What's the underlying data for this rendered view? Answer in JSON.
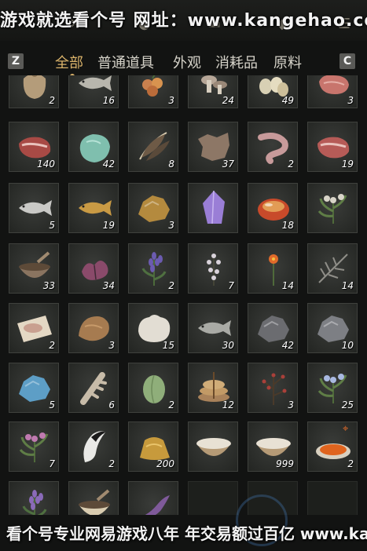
{
  "watermark_top": "游戏就选看个号  网址：www.kangehao.com",
  "watermark_bottom": "看个号专业网易游戏八年  年交易额过百亿 www.kangehao.com",
  "keys": {
    "left": "Z",
    "right": "C"
  },
  "tabs": [
    {
      "label": "全部",
      "active": true
    },
    {
      "label": "普通道具",
      "active": false
    },
    {
      "label": "外观",
      "active": false
    },
    {
      "label": "消耗品",
      "active": false
    },
    {
      "label": "原料",
      "active": false
    }
  ],
  "items": [
    {
      "name": "grain-sack",
      "qty": "2",
      "icon": "sack",
      "color": "#b49c7a"
    },
    {
      "name": "silver-fish",
      "qty": "16",
      "icon": "fish",
      "color": "#b8b6ad"
    },
    {
      "name": "berries",
      "qty": "3",
      "icon": "berries",
      "color": "#c9804e"
    },
    {
      "name": "mushrooms",
      "qty": "24",
      "icon": "mushroom",
      "color": "#b7a798"
    },
    {
      "name": "eggs",
      "qty": "49",
      "icon": "eggs",
      "color": "#d8d0b4"
    },
    {
      "name": "raw-meat-chunks",
      "qty": "3",
      "icon": "meat",
      "color": "#c8756d"
    },
    {
      "name": "beef-steak",
      "qty": "140",
      "icon": "steak",
      "color": "#a84a45"
    },
    {
      "name": "jade-stone",
      "qty": "42",
      "icon": "stone",
      "color": "#7fbfae"
    },
    {
      "name": "feathers",
      "qty": "8",
      "icon": "feather",
      "color": "#6e5a46"
    },
    {
      "name": "animal-hide",
      "qty": "37",
      "icon": "hide",
      "color": "#8d7766"
    },
    {
      "name": "raw-sausage",
      "qty": "2",
      "icon": "sausage",
      "color": "#c79a9a"
    },
    {
      "name": "pork-slab",
      "qty": "19",
      "icon": "steak",
      "color": "#b65b57"
    },
    {
      "name": "salmon",
      "qty": "5",
      "icon": "fish",
      "color": "#c9c9c6"
    },
    {
      "name": "carp",
      "qty": "19",
      "icon": "fish",
      "color": "#c99a44"
    },
    {
      "name": "gold-ore",
      "qty": "3",
      "icon": "ore",
      "color": "#b48a3e"
    },
    {
      "name": "amethyst",
      "qty": "",
      "icon": "crystal",
      "color": "#9a7ed6"
    },
    {
      "name": "red-gem",
      "qty": "18",
      "icon": "gem",
      "color": "#c84a2a"
    },
    {
      "name": "white-flower-herb",
      "qty": "",
      "icon": "herb",
      "color": "#d8d4c8"
    },
    {
      "name": "herb-bowl",
      "qty": "33",
      "icon": "bowl",
      "color": "#8a7460"
    },
    {
      "name": "purple-petals",
      "qty": "34",
      "icon": "petals",
      "color": "#8a4a6a"
    },
    {
      "name": "lavender",
      "qty": "2",
      "icon": "lavender",
      "color": "#6b5bb0"
    },
    {
      "name": "white-blossom",
      "qty": "7",
      "icon": "sprig",
      "color": "#d9d2da"
    },
    {
      "name": "orange-flower",
      "qty": "14",
      "icon": "flower",
      "color": "#e06a2a"
    },
    {
      "name": "pine-twig",
      "qty": "14",
      "icon": "twig",
      "color": "#8f8e88"
    },
    {
      "name": "meat-on-paper",
      "qty": "2",
      "icon": "paper-meat",
      "color": "#c9a090"
    },
    {
      "name": "brown-pelt",
      "qty": "3",
      "icon": "pelt",
      "color": "#a67b50"
    },
    {
      "name": "white-fur",
      "qty": "15",
      "icon": "fur",
      "color": "#e2ddd3"
    },
    {
      "name": "grey-fish",
      "qty": "30",
      "icon": "fish",
      "color": "#a9aaa5"
    },
    {
      "name": "iron-ore",
      "qty": "42",
      "icon": "ore",
      "color": "#6b6c70"
    },
    {
      "name": "dark-rock",
      "qty": "10",
      "icon": "ore",
      "color": "#7d7f84"
    },
    {
      "name": "blue-mineral",
      "qty": "5",
      "icon": "ore",
      "color": "#5d9ec6"
    },
    {
      "name": "bone-fragment",
      "qty": "6",
      "icon": "bone",
      "color": "#c7bba8"
    },
    {
      "name": "green-melon",
      "qty": "2",
      "icon": "melon",
      "color": "#8fae7a"
    },
    {
      "name": "stacked-buns",
      "qty": "12",
      "icon": "buns",
      "color": "#c29a66"
    },
    {
      "name": "red-berry-branch",
      "qty": "3",
      "icon": "branch",
      "color": "#a9403a"
    },
    {
      "name": "blue-wildflower",
      "qty": "25",
      "icon": "herb",
      "color": "#a9b9e0"
    },
    {
      "name": "pink-flower-herb",
      "qty": "7",
      "icon": "herb",
      "color": "#c07ab0"
    },
    {
      "name": "black-white-tail",
      "qty": "2",
      "icon": "tail",
      "color": "#e9e9e6"
    },
    {
      "name": "golden-ingot",
      "qty": "200",
      "icon": "ingot",
      "color": "#c79a3c"
    },
    {
      "name": "milk-bowl",
      "qty": "",
      "icon": "milk",
      "color": "#e8e1d4"
    },
    {
      "name": "milk-bowl-2",
      "qty": "999",
      "icon": "milk",
      "color": "#e8e1d4"
    },
    {
      "name": "orange-dish",
      "qty": "2",
      "icon": "dish",
      "color": "#e0641e",
      "target": true
    },
    {
      "name": "purple-stalk",
      "qty": "",
      "icon": "lavender",
      "color": "#8a6ab8"
    },
    {
      "name": "ceramic-pot",
      "qty": "",
      "icon": "bowl",
      "color": "#d9ccb0"
    },
    {
      "name": "purple-horn",
      "qty": "",
      "icon": "horn",
      "color": "#7f5a9a"
    },
    {
      "name": "empty-1",
      "qty": "",
      "icon": "none",
      "color": "#000"
    },
    {
      "name": "empty-2",
      "qty": "",
      "icon": "none",
      "color": "#000"
    },
    {
      "name": "empty-3",
      "qty": "",
      "icon": "none",
      "color": "#000"
    }
  ]
}
